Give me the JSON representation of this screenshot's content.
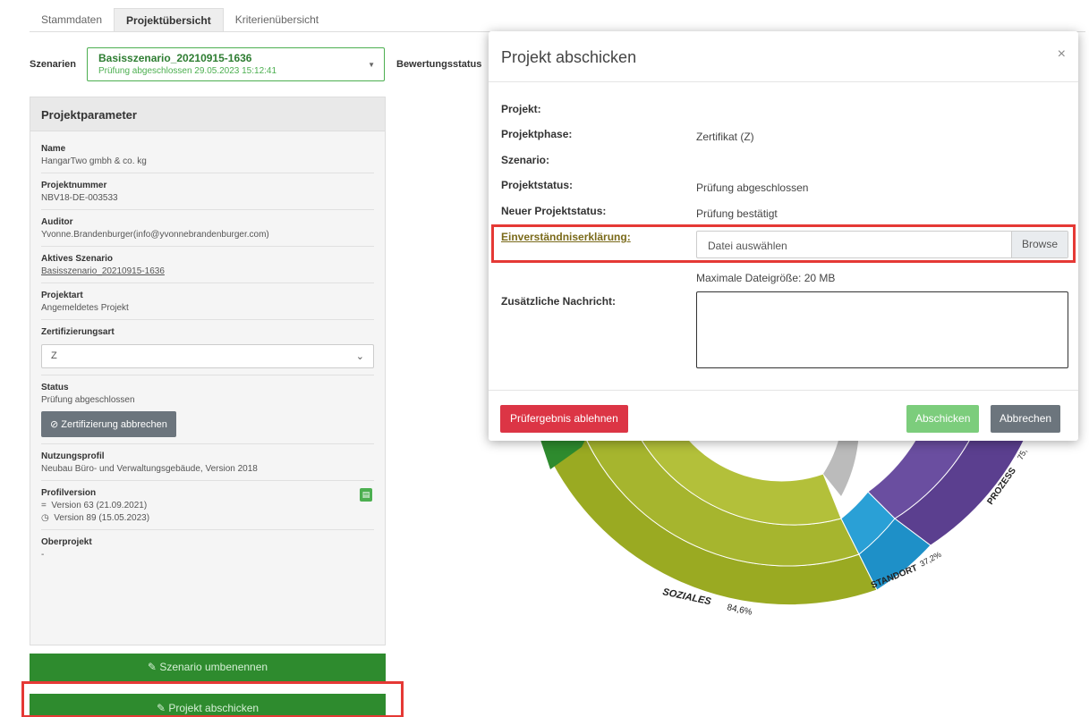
{
  "tabs": [
    "Stammdaten",
    "Projektübersicht",
    "Kriterienübersicht"
  ],
  "scenario": {
    "label": "Szenarien",
    "selected_title": "Basisszenario_20210915-1636",
    "selected_sub": "Prüfung abgeschlossen 29.05.2023 15:12:41",
    "rating_status_label": "Bewertungsstatus"
  },
  "panel": {
    "title": "Projektparameter",
    "name_label": "Name",
    "name_value": "HangarTwo gmbh & co. kg",
    "projnum_label": "Projektnummer",
    "projnum_value": "NBV18-DE-003533",
    "auditor_label": "Auditor",
    "auditor_value": "Yvonne.Brandenburger(info@yvonnebrandenburger.com)",
    "active_label": "Aktives Szenario",
    "active_value": "Basisszenario_20210915-1636",
    "type_label": "Projektart",
    "type_value": "Angemeldetes Projekt",
    "cert_label": "Zertifizierungsart",
    "cert_value": "Z",
    "status_label": "Status",
    "status_value": "Prüfung abgeschlossen",
    "cancel_cert_button": "Zertifizierung abbrechen",
    "usage_label": "Nutzungsprofil",
    "usage_value": "Neubau Büro- und Verwaltungsgebäude, Version 2018",
    "profile_label": "Profilversion",
    "profile_v1": "Version 63 (21.09.2021)",
    "profile_v2": "Version 89 (15.05.2023)",
    "parent_label": "Oberprojekt",
    "parent_value": "-"
  },
  "buttons": {
    "rename": "Szenario umbenennen",
    "submit_project": "Projekt abschicken"
  },
  "chart_labels": {
    "soziales": "SOZIALES",
    "soziales_pct": "84,6%",
    "standort": "STANDORT",
    "standort_pct": "37,2%",
    "prozess": "PROZESS",
    "prozess_pct": "75,"
  },
  "modal": {
    "title": "Projekt abschicken",
    "close": "×",
    "projekt_label": "Projekt:",
    "phase_label": "Projektphase:",
    "phase_value": "Zertifikat (Z)",
    "szenario_label": "Szenario:",
    "status_label": "Projektstatus:",
    "status_value": "Prüfung abgeschlossen",
    "new_status_label": "Neuer Projektstatus:",
    "new_status_value": "Prüfung bestätigt",
    "consent_label": "Einverständniserklärung:",
    "file_placeholder": "Datei auswählen",
    "browse": "Browse",
    "max_size": "Maximale Dateigröße: 20 MB",
    "message_label": "Zusätzliche Nachricht:",
    "reject_button": "Prüfergebnis ablehnen",
    "submit_button": "Abschicken",
    "cancel_button": "Abbrechen"
  },
  "colors": {
    "green": "#2e8b2e",
    "olive": "#9aaa22",
    "blue": "#1e90c8",
    "purple": "#5b3f8f",
    "red": "#dc3545",
    "highlight": "#e53935"
  }
}
